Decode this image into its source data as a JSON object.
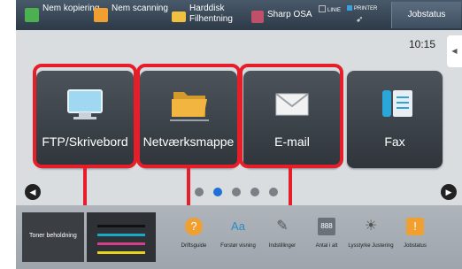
{
  "topbar": {
    "buttons": [
      {
        "label": "Nem kopiering",
        "icon": "copy-icon",
        "color": "#4caf50"
      },
      {
        "label": "Nem scanning",
        "icon": "scan-icon",
        "color": "#f0a030"
      },
      {
        "label": "Harddisk Filhentning",
        "icon": "folder-icon",
        "color": "#f0c040"
      },
      {
        "label": "Sharp OSA",
        "icon": "osa-icon",
        "color": "#c0506a"
      }
    ],
    "status_linie": "LINIE",
    "status_printer": "PRINTER",
    "jobstatus": "Jobstatus"
  },
  "clock": "10:15",
  "tiles": [
    {
      "label": "FTP/Skrivebord",
      "icon": "monitor-icon"
    },
    {
      "label": "Netværksmappe",
      "icon": "network-folder-icon"
    },
    {
      "label": "E-mail",
      "icon": "envelope-icon"
    },
    {
      "label": "Fax",
      "icon": "fax-phone-icon"
    }
  ],
  "pagination": {
    "pages": 5,
    "active": 2
  },
  "bottombar": {
    "toner_label": "Toner beholdning",
    "toner_colors": [
      "#111111",
      "#19a9c6",
      "#d43e8a",
      "#e9d21c"
    ],
    "icons": [
      {
        "label": "Driftsguide",
        "icon": "help-icon"
      },
      {
        "label": "Forstør visning",
        "icon": "zoom-text-icon"
      },
      {
        "label": "Indstillinger",
        "icon": "wrench-icon"
      },
      {
        "label": "Antal i alt",
        "icon": "counter-icon"
      },
      {
        "label": "Lysstyrke Justering",
        "icon": "brightness-icon"
      },
      {
        "label": "Jobstatus",
        "icon": "job-status-icon"
      }
    ]
  },
  "colors": {
    "highlight": "#e61e2a",
    "accent": "#1e6fd6"
  }
}
